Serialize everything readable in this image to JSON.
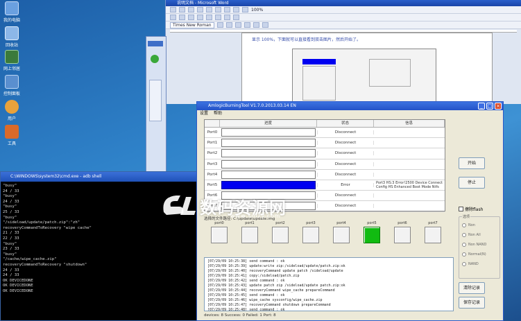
{
  "desktop": {
    "icons": [
      "我的电脑",
      "回收站",
      "网上邻居",
      "控制面板",
      "用户",
      "工具"
    ]
  },
  "word": {
    "title": "说明文档 - Microsoft Word",
    "note": "显示 100%，下面就可以直接看到双击图片，然后开始了。",
    "font_name": "Times New Roman",
    "zoom": "100%"
  },
  "console": {
    "title": "C:\\WINDOWS\\system32\\cmd.exe - adb shell",
    "lines": [
      "\"busy\"",
      "24 / 33",
      "\"busy\"",
      "24 / 33",
      "\"busy\"",
      "25 / 33",
      "\"busy\"",
      "\"/sideload/update/patch.zip\":\"zh\"",
      "recoveryCommandToRecovery \"wipe cache\"",
      "21 / 33",
      "22 / 33",
      "\"busy\"",
      "23 / 33",
      "\"busy\"",
      "\"/cache/wipe_cache.zip\"",
      "recoveryCommandToRecovery \"shutdown\"",
      "24 / 33",
      "24 / 33",
      "OK DEVICEDONE",
      "OK DEVICEDONE",
      "OK DEVICEDONE"
    ]
  },
  "tool": {
    "title": "AmlogicBurningTool  V1.7.0.2013.03.14 EN",
    "menu": [
      "设置",
      "帮助"
    ],
    "columns": {
      "progress": "进度",
      "status": "状态",
      "info": "信息"
    },
    "rows": [
      {
        "port": "Port0",
        "status": "Disconnect",
        "info": "",
        "active": false
      },
      {
        "port": "Port1",
        "status": "Disconnect",
        "info": "",
        "active": false
      },
      {
        "port": "Port2",
        "status": "Disconnect",
        "info": "",
        "active": false
      },
      {
        "port": "Port3",
        "status": "Disconnect",
        "info": "",
        "active": false
      },
      {
        "port": "Port4",
        "status": "Disconnect",
        "info": "",
        "active": false
      },
      {
        "port": "Port5",
        "status": "Error",
        "info": "Port3 HS:3 Error!2500 Device Connect Config HS Enhanced Boot Mode Ntfs",
        "active": true
      },
      {
        "port": "Port6",
        "status": "Disconnect",
        "info": "",
        "active": false
      },
      {
        "port": "Port7",
        "status": "Disconnect",
        "info": "",
        "active": false
      }
    ],
    "path": "选择的文件路径: C:\\update\\update.img",
    "ports": [
      "port0",
      "port1",
      "port2",
      "port3",
      "port4",
      "port5",
      "port6",
      "port7"
    ],
    "ports_active": 5,
    "buttons": {
      "start": "开始",
      "stop": "停止",
      "clear_log": "清除记录",
      "save_log": "保存记录"
    },
    "options": {
      "check": "擦除flash",
      "group": "选项",
      "items": [
        "Non",
        "Non All",
        "Non NAND",
        "Normal(N)",
        "NAND"
      ]
    },
    "log": [
      "[07/29/09 10:25:38]  send command : ok",
      "[07/29/09 10:25:39]  update:write zip:/sideload/update/patch.zip:ok",
      "[07/29/09 10:25:40]  recoveryCommand   update patch /sideload/update",
      "[07/29/09 10:25:41]  copy:/sideload/patch.zip",
      "[07/29/09 10:25:42]  send command : ok",
      "[07/29/09 10:25:43]  update patch zip /sideload/update patch.zip:ok",
      "[07/29/09 10:25:44]  recoveryCommand   wipe_cache prepareCommand",
      "[07/29/09 10:25:45]  send command : ok",
      "[07/29/09 10:25:46]  wipe_cache sysconfig/wipe_cache.zip",
      "[07/29/09 10:25:47]  recoveryCommand   shutdown prepareCommand",
      "[07/29/09 10:25:48]  send command : ok"
    ],
    "status_bar": "devices: 8  Success: 0  Failed: 1  Port: 8"
  },
  "watermark": {
    "text": "数码资源网",
    "url": "www.smzy.com"
  },
  "colors": {
    "progress_active": "#0000f0",
    "port_ok": "#11bb11",
    "title_bar": "#2452c8"
  }
}
